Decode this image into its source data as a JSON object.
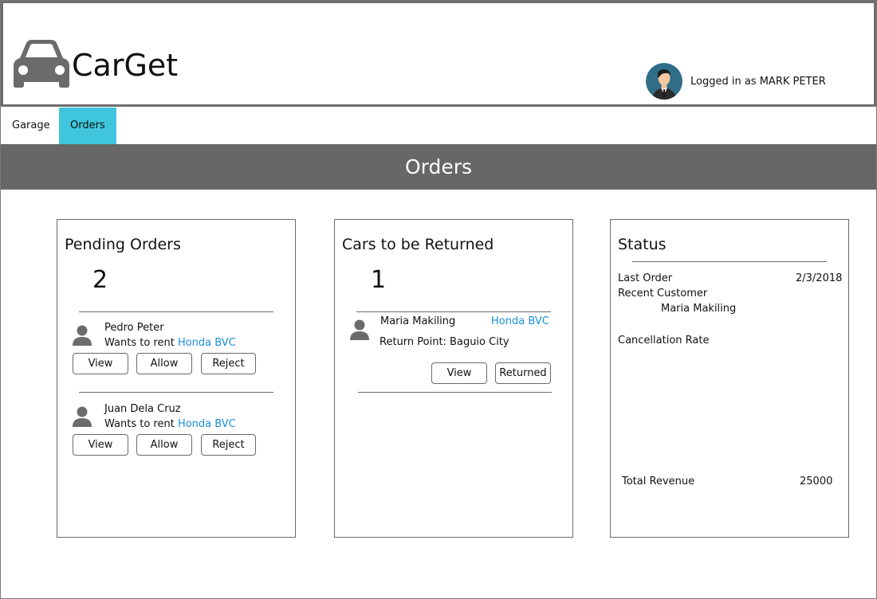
{
  "app": {
    "title": "CarGet",
    "logo_icon": "car-icon"
  },
  "user": {
    "login_text": "Logged in as MARK PETER",
    "avatar_icon": "user-avatar"
  },
  "tabs": [
    {
      "label": "Garage",
      "active": false
    },
    {
      "label": "Orders",
      "active": true
    }
  ],
  "colors": {
    "active_tab": "#3fc6dc",
    "banner": "#676767",
    "link": "#1a8fd8",
    "icon": "#6b6b6b"
  },
  "banner": {
    "title": "Orders"
  },
  "pending": {
    "title": "Pending Orders",
    "count": "2",
    "orders": [
      {
        "name": "Pedro Peter",
        "wants_text": "Wants to rent",
        "car": "Honda BVC",
        "view": "View",
        "allow": "Allow",
        "reject": "Reject"
      },
      {
        "name": "Juan Dela Cruz",
        "wants_text": "Wants to rent",
        "car": "Honda BVC",
        "view": "View",
        "allow": "Allow",
        "reject": "Reject"
      }
    ]
  },
  "returns": {
    "title": "Cars to be Returned",
    "count": "1",
    "items": [
      {
        "name": "Maria Makiling",
        "car": "Honda BVC",
        "return_point": "Return Point: Baguio City",
        "view": "View",
        "returned": "Returned"
      }
    ]
  },
  "status": {
    "title": "Status",
    "last_order_label": "Last Order",
    "last_order_value": "2/3/2018",
    "recent_customer_label": "Recent Customer",
    "recent_customer_value": "Maria Makiling",
    "cancellation_rate_label": "Cancellation Rate",
    "total_revenue_label": "Total Revenue",
    "total_revenue_value": "25000"
  }
}
